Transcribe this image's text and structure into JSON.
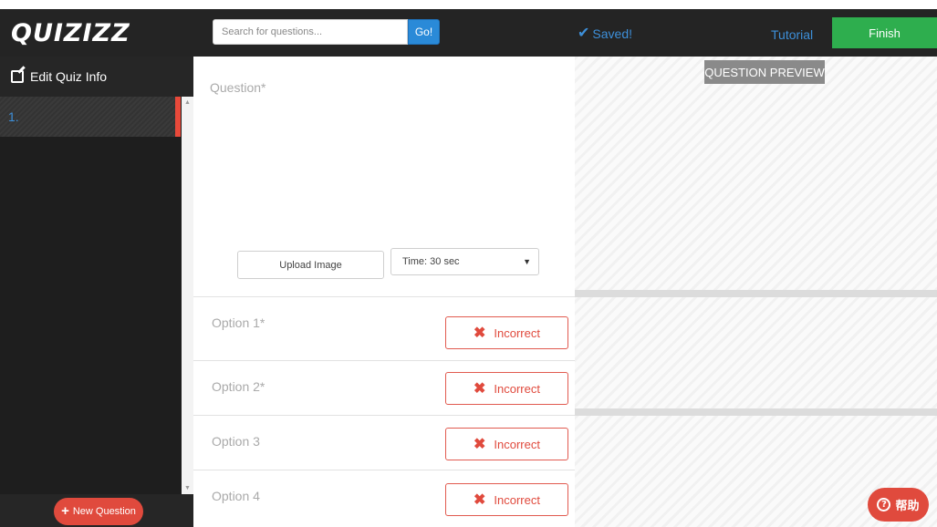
{
  "header": {
    "logo": "QUIZIZZ",
    "search": {
      "placeholder": "Search for questions...",
      "button": "Go!"
    },
    "saved_icon": "checkmark-icon",
    "saved_text": "Saved!",
    "tutorial": "Tutorial",
    "finish": "Finish",
    "colors": {
      "bar": "#242424",
      "link": "#3d8fd9",
      "finish": "#2eae4e"
    }
  },
  "sidebar": {
    "edit_icon": "edit-icon",
    "edit_label": "Edit Quiz Info",
    "questions": [
      {
        "label": "1."
      }
    ],
    "new_question_label": "New Question",
    "colors": {
      "accent": "#e04a3d"
    }
  },
  "editor": {
    "question_placeholder": "Question*",
    "upload_label": "Upload Image",
    "time_value": "Time: 30 sec",
    "options": [
      {
        "label": "Option 1*",
        "status": "Incorrect"
      },
      {
        "label": "Option 2*",
        "status": "Incorrect"
      },
      {
        "label": "Option 3",
        "status": "Incorrect"
      },
      {
        "label": "Option 4",
        "status": "Incorrect"
      }
    ]
  },
  "preview": {
    "label": "QUESTION PREVIEW",
    "help_label": "帮助"
  }
}
